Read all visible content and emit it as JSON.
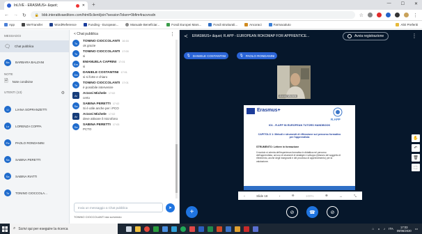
{
  "browser": {
    "tab_title": "bbb.interattivaedit... (truncated)",
    "tab_title_full": "InLIVE - ERASMUS+ &quot;",
    "new_tab": "+",
    "url": "bbb.interattivaeditore.com/html5client/join?sessionToken=9bfim4racvnsdn",
    "bookmarks": [
      "App",
      "WeTransfer",
      "WordReference",
      "Funding - European...",
      "Manuale Beneficiar...",
      "Fondi Europei Mars...",
      "Fondi strutturali...",
      "Ancoraci",
      "Farmacaluto",
      "Altri Preferiti"
    ]
  },
  "left": {
    "messages_title": "MESSAGGI",
    "public_chat": "Chat pubblica",
    "private_user": "BARBARA BALZANI",
    "notes_title": "NOTE",
    "shared_notes": "Note condivise",
    "users_title": "UTENTI (13)",
    "users": [
      {
        "initials": "Li",
        "name": "LIANA SOPRANZETTI"
      },
      {
        "initials": "Lo",
        "name": "LORENZA COPPA"
      },
      {
        "initials": "Pa",
        "name": "PAOLO RONDANINI"
      },
      {
        "initials": "Sa",
        "name": "SABINA PERETTI"
      },
      {
        "initials": "Sa",
        "name": "SABINA RIATTI"
      },
      {
        "initials": "To",
        "name": "TONINO CIOCCOLA..."
      }
    ]
  },
  "chat": {
    "back_label": "< Chat pubblica",
    "messages": [
      {
        "initials": "To",
        "name": "TONINO CIOCCOLANTI",
        "time": "16:16",
        "text": "ok grazie",
        "dark": false
      },
      {
        "initials": "To",
        "name": "TONINO CIOCCOLANTI",
        "time": "17:00",
        "text": "si",
        "dark": false
      },
      {
        "initials": "Em",
        "name": "EMANUELA CAPRINI",
        "time": "17:01",
        "text": "si",
        "dark": false
      },
      {
        "initials": "Da",
        "name": "DANIELE COSTANTINI",
        "time": "17:01",
        "text": "si si forte e chiaro",
        "dark": false
      },
      {
        "initials": "To",
        "name": "TONINO CIOCCOLANTI",
        "time": "17:01",
        "text": "è possibile intervenire",
        "dark": false
      },
      {
        "initials": "Ar",
        "name": "Arzoni Michele",
        "time": "17:02",
        "text": "certo",
        "dark": true
      },
      {
        "initials": "Sa",
        "name": "SABINA PERETTI",
        "time": "17:02",
        "text": "Si è utile anche per i PCO",
        "dark": false
      },
      {
        "initials": "Ar",
        "name": "Arzoni Michele",
        "time": "17:02",
        "text": "deve attivare il microfono",
        "dark": true
      },
      {
        "initials": "Sa",
        "name": "SABINA PERETTI",
        "time": "17:03",
        "text": "PCTO",
        "dark": false
      }
    ],
    "input_placeholder": "Invia un messaggio a Chat pubblica",
    "typing": "TONINO CIOCCOLANTI sta scrivendo"
  },
  "main": {
    "meeting_title": "ERASMUS+ &quot; R.APP - EUROPEAN ROKOMAP FOR APPRENTICE...",
    "record_label": "Avvia registrazione",
    "presenters": [
      "DANIELE COSTANTINI",
      "PAOLO RONDANINI"
    ],
    "webcam_label": "Arzoni Michele",
    "slide": {
      "brand": "Erasmus+",
      "project": "R.APP",
      "heading": "IO1 - R.APP IN EUROPEAN TUTORS HANDBOOK",
      "chapter": "CAPITOLO 1: Metodi e strumenti di riflessione sul percorso formativo per l'apprendista",
      "section": "STRUMENTO: Lettere in formazione",
      "body": "Il modulo si orienta dell'esperienza formativa in didattica nel percorso dell'apprendista, ad uso di strumenti di strategie e sviluppo (bilancio del soggetto di riferimento, anche degli insegnanti e del processo di apprendimento) per la valutazione."
    },
    "slide_control": "Slide 18",
    "zoom": "100%"
  },
  "taskbar": {
    "search": "Scrivi qui per eseguire la ricerca",
    "time": "17:03",
    "date": "09/06/2020",
    "lang": "ITA"
  }
}
